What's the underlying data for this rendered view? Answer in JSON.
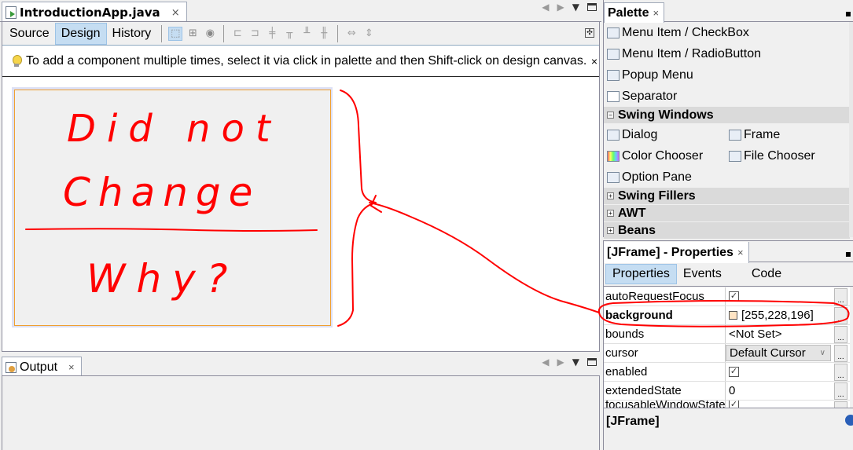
{
  "editor": {
    "tab_title": "IntroductionApp.java",
    "tab_close": "×",
    "views": [
      {
        "label": "Source",
        "active": false
      },
      {
        "label": "Design",
        "active": true
      },
      {
        "label": "History",
        "active": false
      }
    ],
    "hint_text": "To add a component multiple times, select it via click in palette and then Shift-click on design canvas.",
    "hint_close": "×"
  },
  "annotation": {
    "line1": "Did not",
    "line2": "Change",
    "line3": "Why?",
    "color": "#ff0000"
  },
  "output": {
    "tab_title": "Output",
    "tab_close": "×"
  },
  "palette": {
    "tab_title": "Palette",
    "tab_close": "×",
    "menu_items": [
      {
        "label": "Menu Item / CheckBox",
        "icon": "menu-checkbox-icon"
      },
      {
        "label": "Menu Item / RadioButton",
        "icon": "menu-radio-icon"
      },
      {
        "label": "Popup Menu",
        "icon": "popup-menu-icon"
      },
      {
        "label": "Separator",
        "icon": "separator-icon"
      }
    ],
    "swing_windows": {
      "label": "Swing Windows",
      "expanded": true,
      "items": [
        {
          "label": "Dialog",
          "icon": "dialog-icon"
        },
        {
          "label": "Frame",
          "icon": "frame-icon"
        },
        {
          "label": "Color Chooser",
          "icon": "color-chooser-icon"
        },
        {
          "label": "File Chooser",
          "icon": "file-chooser-icon"
        },
        {
          "label": "Option Pane",
          "icon": "option-pane-icon"
        }
      ]
    },
    "categories": [
      {
        "label": "Swing Fillers",
        "expanded": false
      },
      {
        "label": "AWT",
        "expanded": false
      },
      {
        "label": "Beans",
        "expanded": false
      }
    ]
  },
  "properties": {
    "tab_title": "[JFrame] - Properties",
    "tab_close": "×",
    "subtabs": [
      {
        "label": "Properties",
        "active": true
      },
      {
        "label": "Events",
        "active": false
      },
      {
        "label": "Code",
        "active": false
      }
    ],
    "rows": [
      {
        "name": "autoRequestFocus",
        "type": "checkbox",
        "value": "☑",
        "bold": false
      },
      {
        "name": "background",
        "type": "color",
        "value": "[255,228,196]",
        "swatch": "#ffe4c4",
        "bold": true
      },
      {
        "name": "bounds",
        "type": "text",
        "value": "<Not Set>",
        "bold": false
      },
      {
        "name": "cursor",
        "type": "combo",
        "value": "Default Cursor",
        "bold": false
      },
      {
        "name": "enabled",
        "type": "checkbox",
        "value": "☑",
        "bold": false
      },
      {
        "name": "extendedState",
        "type": "text",
        "value": "0",
        "bold": false
      },
      {
        "name": "focusableWindowState",
        "type": "checkbox",
        "value": "☑",
        "bold": false
      }
    ],
    "ellipsis": "..."
  },
  "description": {
    "title": "[JFrame]"
  }
}
